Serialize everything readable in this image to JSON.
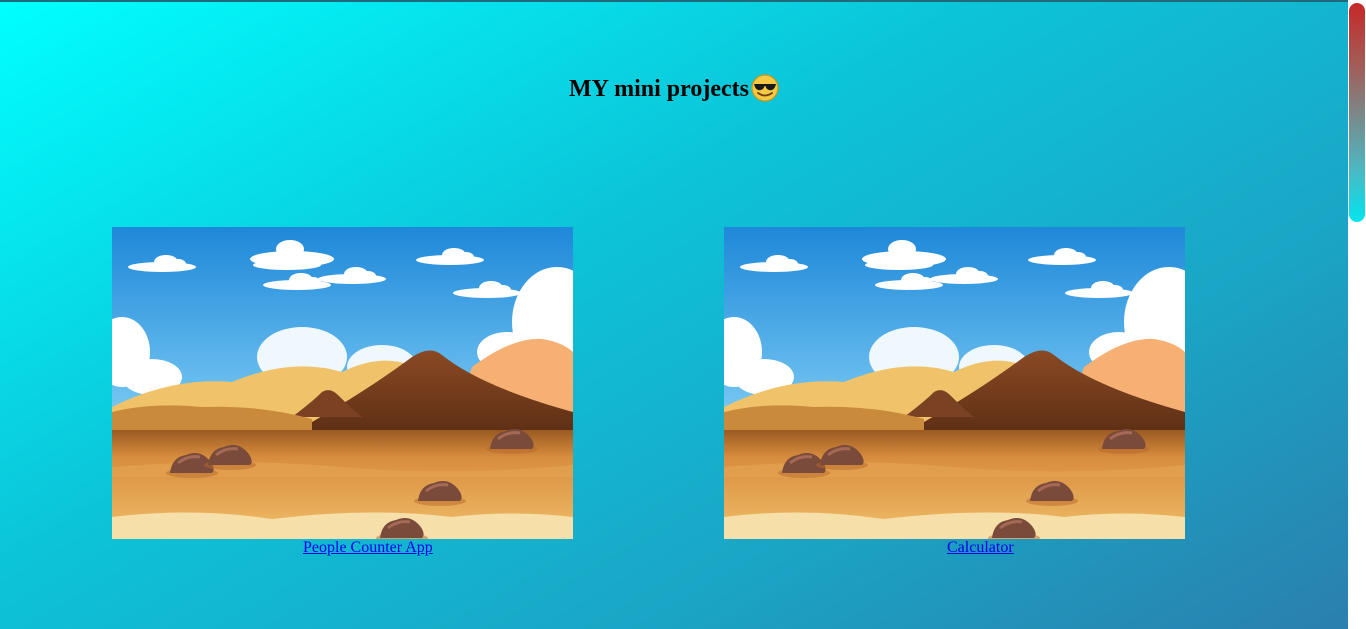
{
  "page": {
    "title": "MY mini projects",
    "title_emoji_icon": "sunglasses-face-icon"
  },
  "projects": [
    {
      "label": "People Counter App",
      "image": "desert-landscape-illustration"
    },
    {
      "label": "Calculator",
      "image": "desert-landscape-illustration"
    }
  ],
  "colors": {
    "gradient_start": "#00ffff",
    "gradient_end": "#2a7fae",
    "link": "#0000ee",
    "scroll_thumb_top": "#c62828",
    "scroll_thumb_bottom": "#00e5ef"
  }
}
